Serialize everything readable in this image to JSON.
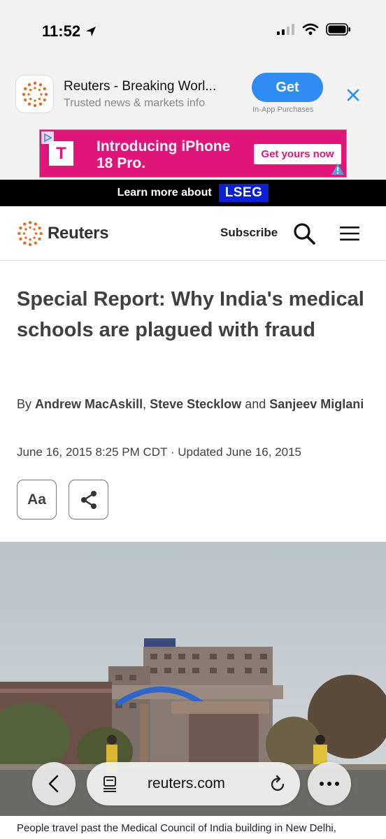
{
  "status_bar": {
    "time": "11:52"
  },
  "app_banner": {
    "title": "Reuters - Breaking Worl...",
    "subtitle": "Trusted news & markets info",
    "get_label": "Get",
    "iap_label": "In-App Purchases"
  },
  "ad": {
    "logo": "T",
    "headline": "Introducing iPhone 18 Pro.",
    "cta": "Get yours now",
    "brand_color": "#e0157a"
  },
  "lseg_bar": {
    "text": "Learn more about",
    "logo": "LSEG"
  },
  "header": {
    "brand": "Reuters",
    "subscribe": "Subscribe"
  },
  "article": {
    "headline": "Special Report: Why India's medical schools are plagued with fraud",
    "by": "By",
    "author1": "Andrew MacAskill",
    "sep1": ",",
    "author2": "Steve Stecklow",
    "and": "and",
    "author3": "Sanjeev Miglani",
    "dateline": "June 16, 2015 8:25 PM CDT · Updated June 16, 2015",
    "text_size_label": "Aa",
    "caption": "People travel past the Medical Council of India building in New Delhi,"
  },
  "browser": {
    "url": "reuters.com"
  },
  "colors": {
    "accent": "#2f8cf2",
    "reuters_orange": "#e46d24",
    "lseg_blue": "#0a1fd6"
  }
}
